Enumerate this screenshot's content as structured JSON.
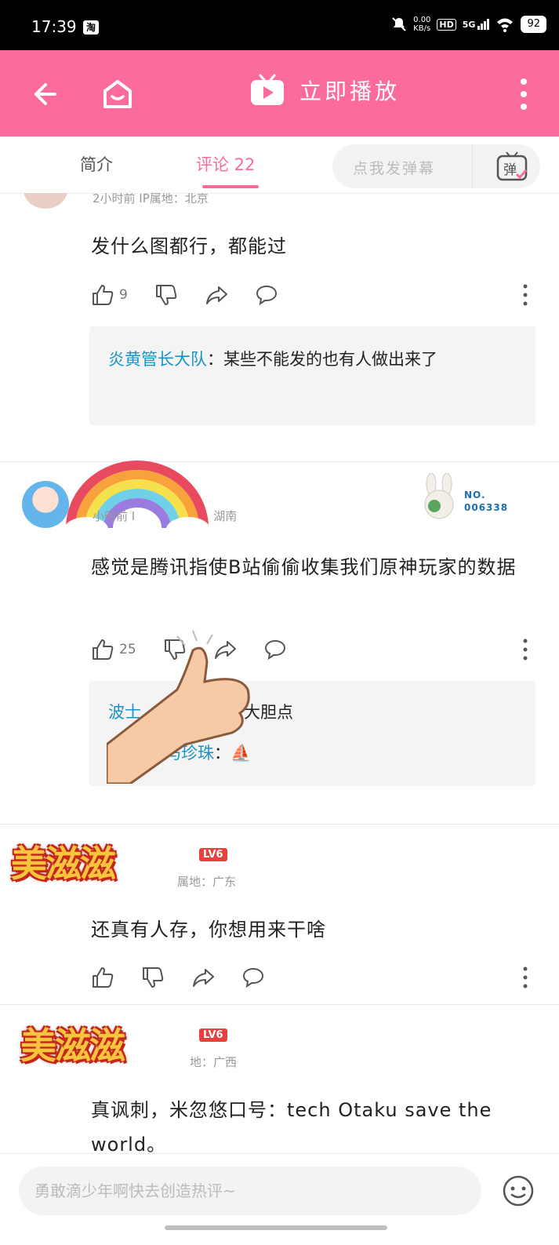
{
  "status_bar": {
    "time": "17:39",
    "app_badge": "淘",
    "net_speed": "0.00",
    "net_unit": "KB/s",
    "hd_label": "HD",
    "network_label": "5G",
    "battery": "92"
  },
  "app_bar": {
    "back_icon": "back-arrow-icon",
    "home_icon": "home-icon",
    "play_label": "立即播放",
    "more_icon": "more-vertical-icon"
  },
  "tabs": {
    "intro": "简介",
    "comments": "评论 22",
    "danmaku_placeholder": "点我发弹幕",
    "danmaku_icon_label": "弹"
  },
  "comments": [
    {
      "meta": "2小时前  IP属地：北京",
      "body": "发什么图都行，都能过",
      "like_count": "9",
      "replies": [
        {
          "name": "炎黄管长大队",
          "text": "：某些不能发的也有人做出来了"
        }
      ]
    },
    {
      "meta": "小时前  I",
      "meta_location": "湖南",
      "body": "感觉是腾讯指使B站偷偷收集我们原神玩家的数据",
      "like_count": "25",
      "badge_no": "NO.",
      "badge_num": "006338",
      "replies": [
        {
          "name": "波士",
          "text": "：大胆点"
        },
        {
          "name": "的小马珍珠",
          "text": "：⛵"
        }
      ]
    },
    {
      "sticker": "美滋滋",
      "level": "LV6",
      "meta": "属地：广东",
      "body": "还真有人存，你想用来干啥"
    },
    {
      "sticker": "美滋滋",
      "level": "LV6",
      "meta": "地：广西",
      "body": "真讽刺，米忽悠口号：tech Otaku save the world。"
    }
  ],
  "bottom_bar": {
    "input_placeholder": "勇敢滴少年啊快去创造热评~",
    "emoji_icon": "emoji-icon"
  },
  "colors": {
    "brand_pink": "#fb6b9d",
    "reply_name_blue": "#1894c6",
    "level_red": "#e8403c"
  }
}
